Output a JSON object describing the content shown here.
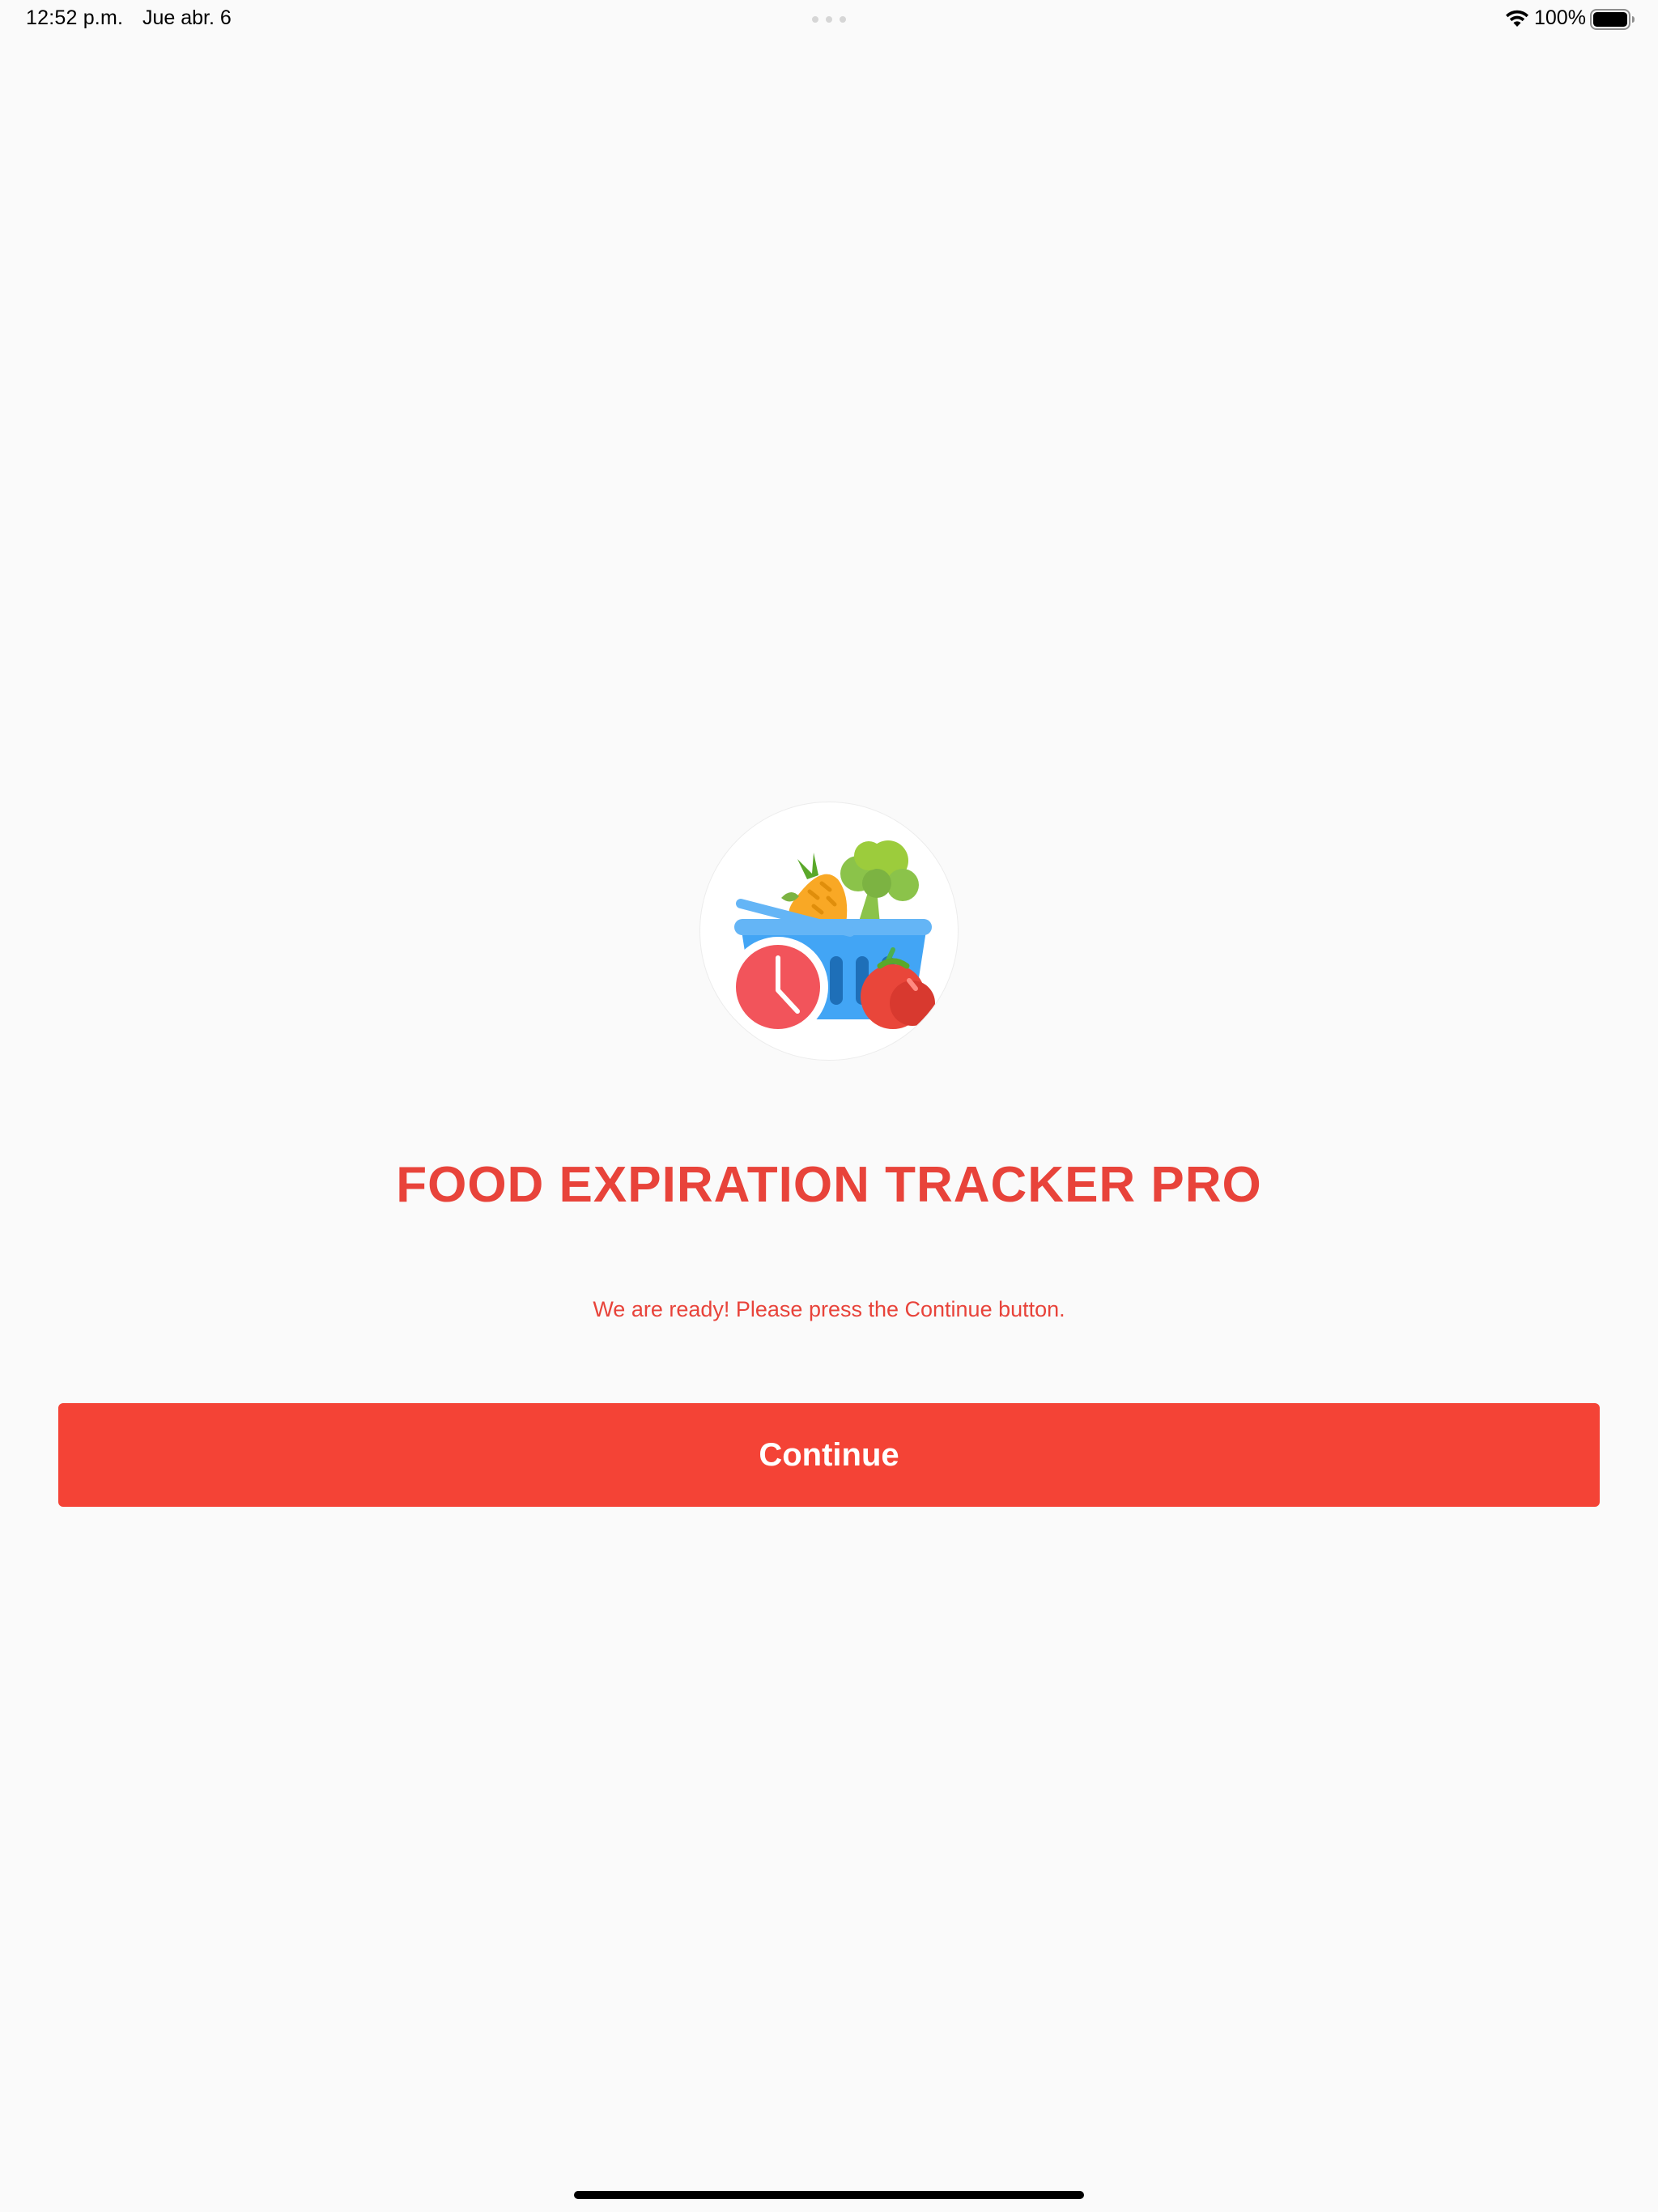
{
  "status_bar": {
    "time": "12:52 p.m.",
    "date": "Jue abr. 6",
    "battery_percent": "100%",
    "battery_level": 1.0,
    "icons": [
      "multitasking-dots-icon",
      "wifi-icon",
      "battery-icon"
    ]
  },
  "logo": {
    "icon": "food-basket-clock-icon"
  },
  "main": {
    "title": "FOOD EXPIRATION TRACKER PRO",
    "message": "We are ready! Please press the Continue button.",
    "continue_label": "Continue"
  },
  "colors": {
    "accent": "#f44336",
    "title_text": "#e8433a",
    "background": "#fafafa"
  }
}
